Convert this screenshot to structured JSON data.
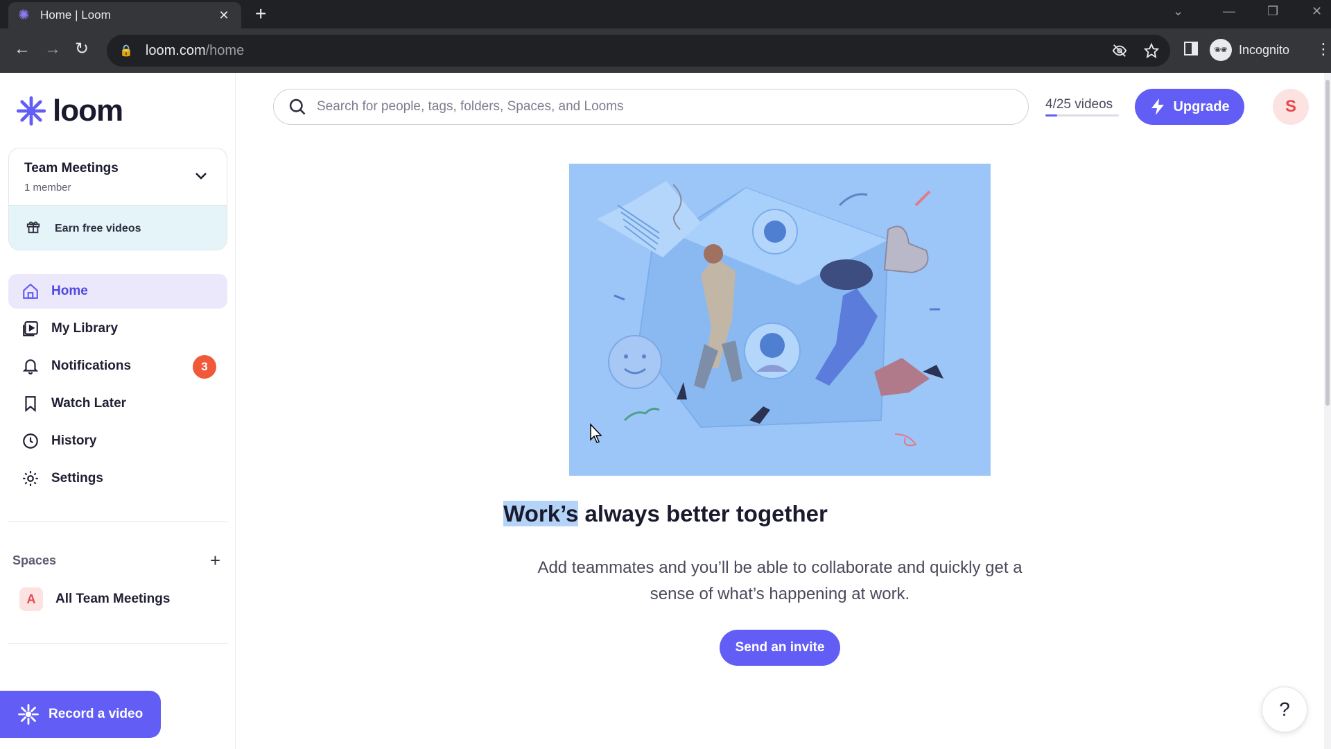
{
  "browser": {
    "tab_title": "Home | Loom",
    "tab_close": "✕",
    "new_tab": "+",
    "url_host": "loom.com",
    "url_path": "/home",
    "profile_label": "Incognito"
  },
  "sidebar": {
    "brand": "loom",
    "workspace": {
      "name": "Team Meetings",
      "members": "1 member",
      "earn_label": "Earn free videos"
    },
    "nav": [
      {
        "label": "Home",
        "icon": "home-icon",
        "active": true
      },
      {
        "label": "My Library",
        "icon": "library-icon"
      },
      {
        "label": "Notifications",
        "icon": "bell-icon",
        "badge": "3"
      },
      {
        "label": "Watch Later",
        "icon": "bookmark-icon"
      },
      {
        "label": "History",
        "icon": "clock-icon"
      },
      {
        "label": "Settings",
        "icon": "gear-icon"
      }
    ],
    "spaces_title": "Spaces",
    "spaces": [
      {
        "avatar": "A",
        "label": "All Team Meetings"
      }
    ],
    "record_label": "Record a video"
  },
  "header": {
    "search_placeholder": "Search for people, tags, folders, Spaces, and Looms",
    "video_count": "4/25 videos",
    "video_usage_fraction": 0.16,
    "upgrade_label": "Upgrade",
    "user_initial": "S"
  },
  "main": {
    "headline_highlight": "Work’s",
    "headline_rest": " always better together",
    "subtext": "Add teammates and you’ll be able to collaborate and quickly get a sense of what’s happening at work.",
    "invite_label": "Send an invite",
    "help_label": "?"
  },
  "colors": {
    "accent": "#625df5",
    "badge": "#f05a3a",
    "hero_bg": "#9cc6f8"
  }
}
